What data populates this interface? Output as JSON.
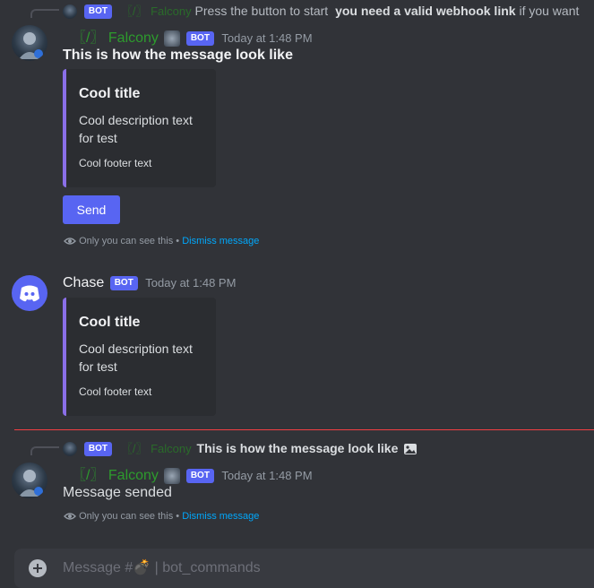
{
  "message1": {
    "reply": {
      "bot_tag": "BOT",
      "author": "〖/〗 Falcony",
      "text_plain": "Press the button to start",
      "text_bold": "you need a valid webhook link",
      "text_tail": "if you want"
    },
    "author": "〖/〗 Falcony",
    "bot_tag": "BOT",
    "timestamp": "Today at 1:48 PM",
    "content_bold": "This is how the message look like",
    "embed": {
      "title": "Cool title",
      "description": "Cool description text for test",
      "footer": "Cool footer text"
    },
    "button_label": "Send",
    "ephemeral": {
      "text": "Only you can see this",
      "separator": "•",
      "link": "Dismiss message"
    }
  },
  "message2": {
    "author": "Chase",
    "bot_tag": "BOT",
    "timestamp": "Today at 1:48 PM",
    "embed": {
      "title": "Cool title",
      "description": "Cool description text for test",
      "footer": "Cool footer text"
    }
  },
  "message3": {
    "reply": {
      "bot_tag": "BOT",
      "author": "〖/〗 Falcony",
      "text_bold": "This is how the message look like"
    },
    "author": "〖/〗 Falcony",
    "bot_tag": "BOT",
    "timestamp": "Today at 1:48 PM",
    "content": "Message sended",
    "ephemeral": {
      "text": "Only you can see this",
      "separator": "•",
      "link": "Dismiss message"
    }
  },
  "composer": {
    "placeholder": "Message #💣 | bot_commands"
  },
  "colors": {
    "background": "#313338",
    "blurple": "#5865f2",
    "embed_accent": "#8a6fe8",
    "new_divider": "#f23f43",
    "link": "#00a8fc",
    "falcony_name": "#2d9b2d"
  },
  "icons": [
    "reply-avatar",
    "bomb-emoji",
    "eye-icon",
    "discord-logo",
    "image-icon",
    "add-attachment-icon"
  ]
}
